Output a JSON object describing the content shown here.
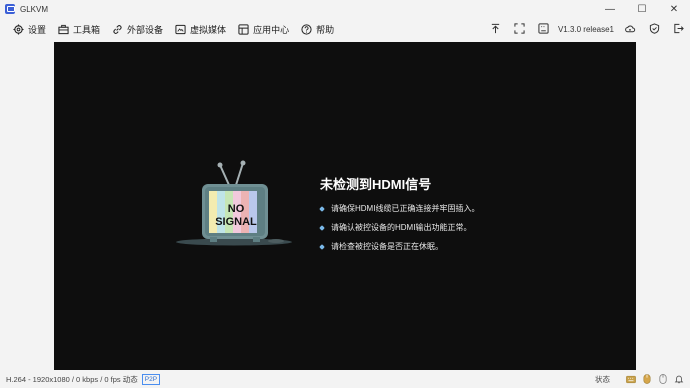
{
  "window": {
    "title": "GLKVM",
    "controls": {
      "minimize": "—",
      "maximize": "☐",
      "close": "✕"
    }
  },
  "menu": [
    {
      "label": "设置",
      "icon": "gear-icon"
    },
    {
      "label": "工具箱",
      "icon": "toolbox-icon"
    },
    {
      "label": "外部设备",
      "icon": "link-icon"
    },
    {
      "label": "虚拟媒体",
      "icon": "media-icon"
    },
    {
      "label": "应用中心",
      "icon": "app-center-icon"
    },
    {
      "label": "帮助",
      "icon": "help-icon"
    }
  ],
  "toolbar_right": {
    "version": "V1.3.0 release1",
    "icons": [
      "upload-icon",
      "fullscreen-icon",
      "keyboard-icon",
      "cloud-icon",
      "shield-icon",
      "logout-icon"
    ]
  },
  "video": {
    "tv_text_line1": "NO",
    "tv_text_line2": "SIGNAL",
    "title": "未检测到HDMI信号",
    "tips": [
      "请确保HDMI线缆已正确连接并牢固插入。",
      "请确认被控设备的HDMI输出功能正常。",
      "请检查被控设备是否正在休眠。"
    ]
  },
  "status": {
    "stream_info": "H.264 - 1920x1080 / 0 kbps / 0 fps 动态",
    "p2p_badge": "P2P",
    "right_label": "状态",
    "right_icons": [
      "keyboard-status-icon",
      "mouse-status-icon",
      "mouse-status-icon-2",
      "bell-icon"
    ]
  },
  "colors": {
    "video_bg": "#0e0e0e",
    "bullet": "#7ab8e8",
    "accent": "#2f6fd0"
  }
}
